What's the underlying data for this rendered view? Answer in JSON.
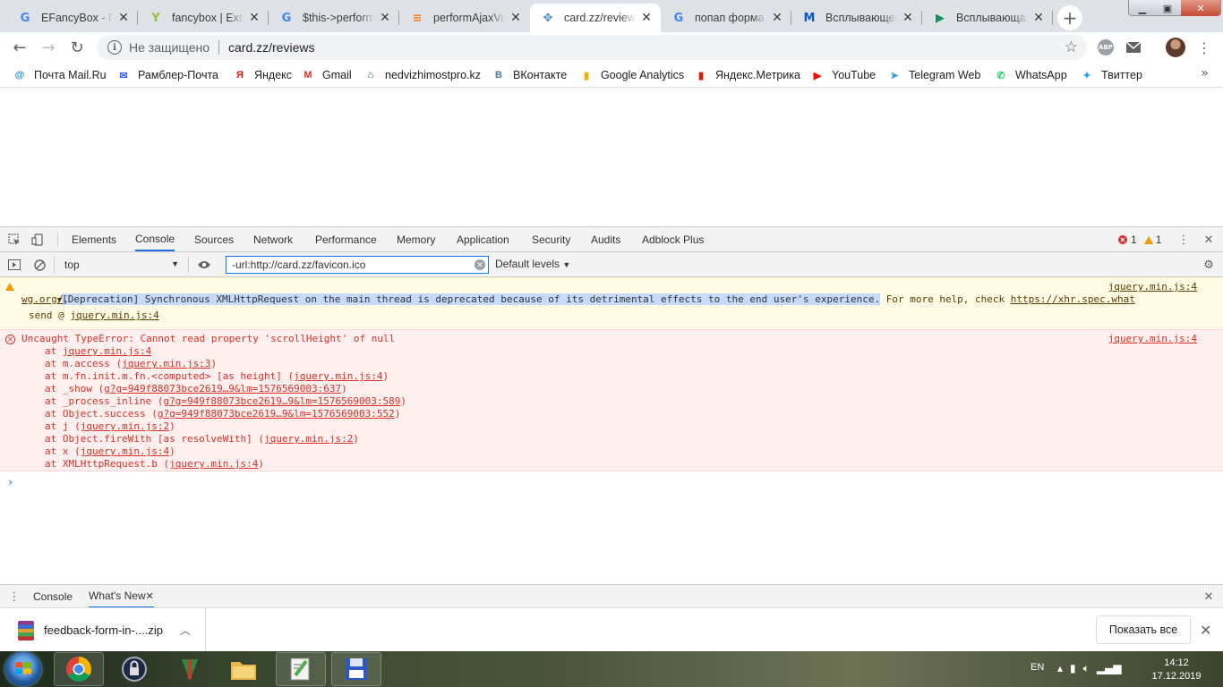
{
  "tabs": [
    {
      "title": "EFancyBox - По",
      "favicon": "google-g",
      "color": "#4285f4"
    },
    {
      "title": "fancybox | Exte",
      "favicon": "yii-logo",
      "color": "#9bc13c"
    },
    {
      "title": "$this->perform",
      "favicon": "google-g",
      "color": "#4285f4"
    },
    {
      "title": "performAjaxVal",
      "favicon": "stackoverflow",
      "color": "#f48024"
    },
    {
      "title": "card.zz/reviews",
      "favicon": "cross-arrows",
      "color": "#4a90c2",
      "active": true
    },
    {
      "title": "попап форма",
      "favicon": "google-g",
      "color": "#4285f4"
    },
    {
      "title": "Всплывающее",
      "favicon": "m-logo",
      "color": "#0b57d0"
    },
    {
      "title": "Всплывающая",
      "favicon": "play-logo",
      "color": "#1a8f5c"
    }
  ],
  "toolbar": {
    "secure_label": "Не защищено",
    "url": "card.zz/reviews",
    "abp_label": "ABP"
  },
  "bookmarks": [
    {
      "label": "Почта Mail.Ru",
      "icon": "mailru-icon",
      "color": "#168de2",
      "glyph": "@"
    },
    {
      "label": "Рамблер-Почта",
      "icon": "rambler-icon",
      "color": "#315efb",
      "glyph": "✉"
    },
    {
      "label": "Яндекс",
      "icon": "yandex-icon",
      "color": "#e61400",
      "glyph": "Я"
    },
    {
      "label": "Gmail",
      "icon": "gmail-icon",
      "color": "#d93025",
      "glyph": "M"
    },
    {
      "label": "nedvizhimostpro.kz",
      "icon": "house-icon",
      "color": "#1f4fa0",
      "glyph": "⌂"
    },
    {
      "label": "ВКонтакте",
      "icon": "vk-icon",
      "color": "#4a76a8",
      "glyph": "B"
    },
    {
      "label": "Google Analytics",
      "icon": "analytics-icon",
      "color": "#f9ab00",
      "glyph": "▮"
    },
    {
      "label": "Яндекс.Метрика",
      "icon": "metrika-icon",
      "color": "#e61400",
      "glyph": "▮"
    },
    {
      "label": "YouTube",
      "icon": "youtube-icon",
      "color": "#ff0000",
      "glyph": "▶"
    },
    {
      "label": "Telegram Web",
      "icon": "telegram-icon",
      "color": "#2ca5e0",
      "glyph": "➤"
    },
    {
      "label": "WhatsApp",
      "icon": "whatsapp-icon",
      "color": "#25d366",
      "glyph": "✆"
    },
    {
      "label": "Твиттер",
      "icon": "twitter-icon",
      "color": "#1da1f2",
      "glyph": "✦"
    }
  ],
  "devtools": {
    "tabs": [
      "Elements",
      "Console",
      "Sources",
      "Network",
      "Performance",
      "Memory",
      "Application",
      "Security",
      "Audits",
      "Adblock Plus"
    ],
    "active_tab": "Console",
    "error_count": "1",
    "warning_count": "1",
    "context": "top",
    "filter_value": "-url:http://card.zz/favicon.ico",
    "levels": "Default levels",
    "warning": {
      "highlighted": "[Deprecation] Synchronous XMLHttpRequest on the main thread is deprecated because of its detrimental effects to the end user's experience.",
      "rest": " For more help, check ",
      "link1": "https://xhr.spec.what",
      "link2": "wg.org/",
      "link2_tail": ".",
      "send_prefix": "send @ ",
      "send_link": "jquery.min.js:4",
      "source": "jquery.min.js:4"
    },
    "error": {
      "message": "Uncaught TypeError: Cannot read property 'scrollHeight' of null",
      "source": "jquery.min.js:4",
      "stack": [
        {
          "pre": "at ",
          "link": "jquery.min.js:4",
          "post": ""
        },
        {
          "pre": "at m.access (",
          "link": "jquery.min.js:3",
          "post": ")"
        },
        {
          "pre": "at m.fn.init.m.fn.<computed> [as height] (",
          "link": "jquery.min.js:4",
          "post": ")"
        },
        {
          "pre": "at _show (",
          "link": "g?g=949f88073bce2619…9&lm=1576569003:637",
          "post": ")"
        },
        {
          "pre": "at _process_inline (",
          "link": "g?g=949f88073bce2619…9&lm=1576569003:589",
          "post": ")"
        },
        {
          "pre": "at Object.success (",
          "link": "g?g=949f88073bce2619…9&lm=1576569003:552",
          "post": ")"
        },
        {
          "pre": "at j (",
          "link": "jquery.min.js:2",
          "post": ")"
        },
        {
          "pre": "at Object.fireWith [as resolveWith] (",
          "link": "jquery.min.js:2",
          "post": ")"
        },
        {
          "pre": "at x (",
          "link": "jquery.min.js:4",
          "post": ")"
        },
        {
          "pre": "at XMLHttpRequest.b (",
          "link": "jquery.min.js:4",
          "post": ")"
        }
      ]
    },
    "prompt": "›",
    "drawer_tabs": [
      "Console",
      "What's New"
    ],
    "drawer_active": "What's New"
  },
  "download": {
    "filename": "feedback-form-in-....zip",
    "show_all": "Показать все"
  },
  "taskbar": {
    "lang": "EN",
    "time": "14:12",
    "date": "17.12.2019"
  }
}
